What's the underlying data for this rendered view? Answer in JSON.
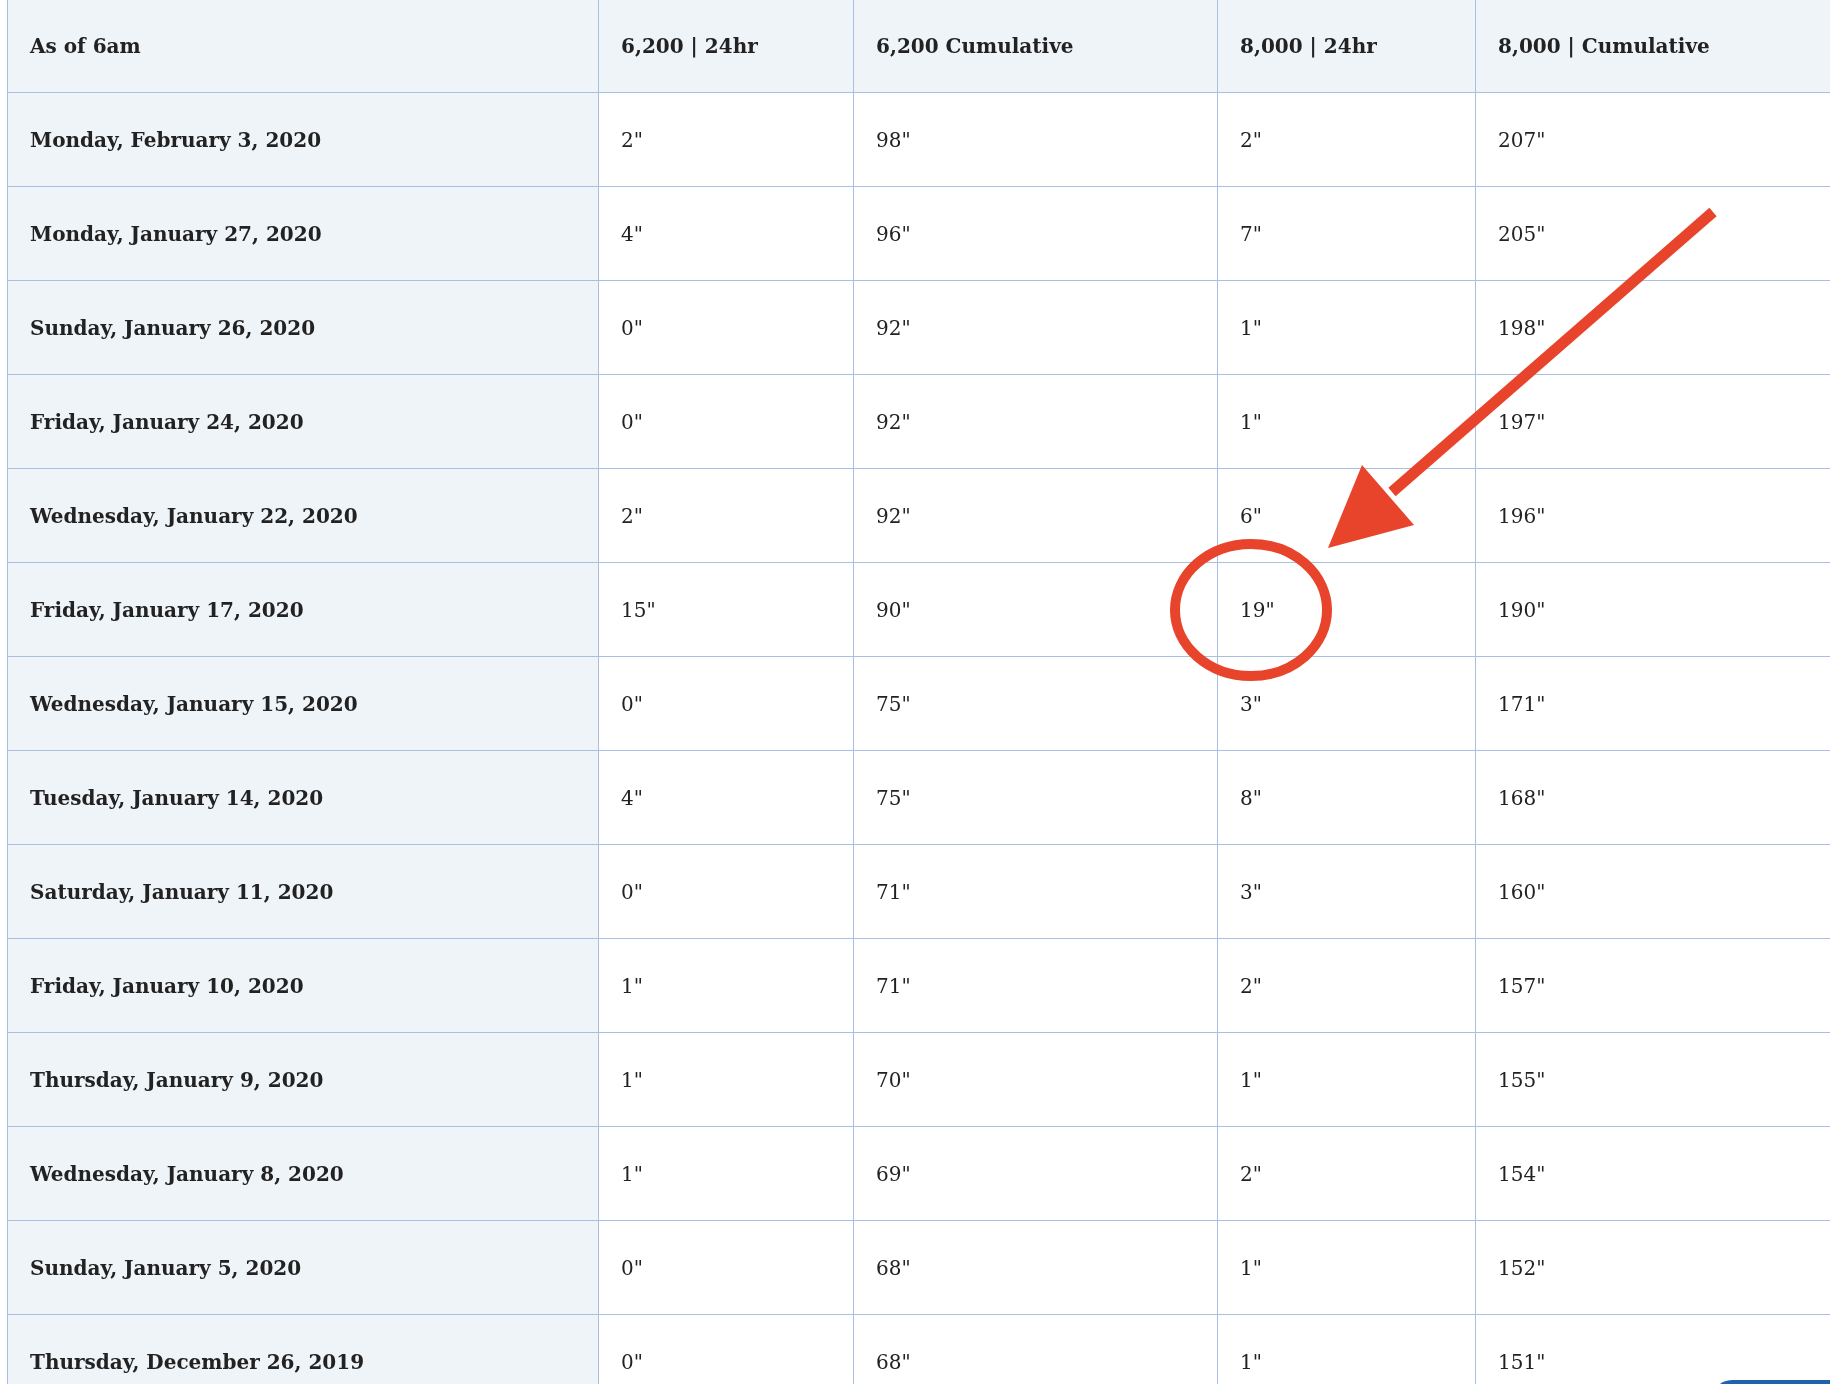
{
  "table": {
    "columns": [
      "As of 6am",
      "6,200 | 24hr",
      "6,200 Cumulative",
      "8,000 | 24hr",
      "8,000 | Cumulative"
    ],
    "rows": [
      [
        "Monday, February 3, 2020",
        "2\"",
        "98\"",
        "2\"",
        "207\""
      ],
      [
        "Monday, January 27, 2020",
        "4\"",
        "96\"",
        "7\"",
        "205\""
      ],
      [
        "Sunday, January 26, 2020",
        "0\"",
        "92\"",
        "1\"",
        "198\""
      ],
      [
        "Friday, January 24, 2020",
        "0\"",
        "92\"",
        "1\"",
        "197\""
      ],
      [
        "Wednesday, January 22, 2020",
        "2\"",
        "92\"",
        "6\"",
        "196\""
      ],
      [
        "Friday, January 17, 2020",
        "15\"",
        "90\"",
        "19\"",
        "190\""
      ],
      [
        "Wednesday, January 15, 2020",
        "0\"",
        "75\"",
        "3\"",
        "171\""
      ],
      [
        "Tuesday, January 14, 2020",
        "4\"",
        "75\"",
        "8\"",
        "168\""
      ],
      [
        "Saturday, January 11, 2020",
        "0\"",
        "71\"",
        "3\"",
        "160\""
      ],
      [
        "Friday, January 10, 2020",
        "1\"",
        "71\"",
        "2\"",
        "157\""
      ],
      [
        "Thursday, January 9, 2020",
        "1\"",
        "70\"",
        "1\"",
        "155\""
      ],
      [
        "Wednesday, January 8, 2020",
        "1\"",
        "69\"",
        "2\"",
        "154\""
      ],
      [
        "Sunday, January 5, 2020",
        "0\"",
        "68\"",
        "1\"",
        "152\""
      ],
      [
        "Thursday, December 26, 2019",
        "0\"",
        "68\"",
        "1\"",
        "151\""
      ]
    ]
  }
}
